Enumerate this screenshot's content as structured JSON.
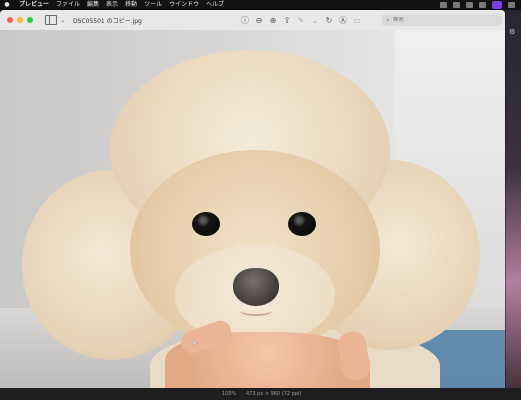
{
  "menubar": {
    "apple": "",
    "items": [
      "プレビュー",
      "ファイル",
      "編集",
      "表示",
      "移動",
      "ツール",
      "ウインドウ",
      "ヘルプ"
    ]
  },
  "window": {
    "title": "DSC05501 のコピー.jpg",
    "search_placeholder": "検索"
  },
  "toolbar": {
    "icons": [
      "info-icon",
      "zoom-out-icon",
      "zoom-in-icon",
      "share-icon",
      "markup-icon",
      "markup-chevron-icon",
      "rotate-icon",
      "highlight-icon",
      "form-icon"
    ]
  },
  "status": {
    "zoom": "100%",
    "dimensions": "473 px × 960 (72 ppi)"
  },
  "colors": {
    "accent": "#7e3fe0",
    "close": "#fe5f57",
    "minimize": "#febc2e",
    "zoom": "#28c840"
  }
}
